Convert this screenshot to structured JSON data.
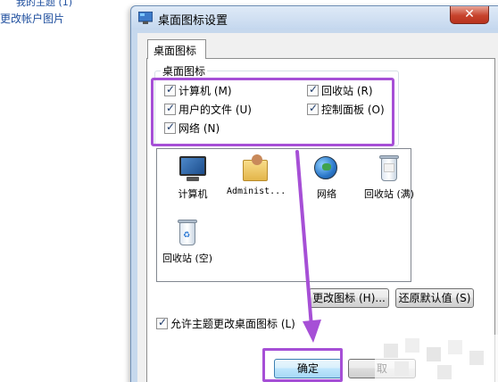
{
  "background": {
    "cut_text": "我的主题 (1)",
    "link": "更改帐户图片"
  },
  "dialog": {
    "title": "桌面图标设置",
    "close_label": "✕",
    "tab_label": "桌面图标",
    "group_label": "桌面图标",
    "checkboxes": {
      "computer": "计算机 (M)",
      "recycle_bin": "回收站 (R)",
      "user_files": "用户的文件 (U)",
      "control_panel": "控制面板 (O)",
      "network": "网络 (N)"
    },
    "icons": [
      {
        "label": "计算机",
        "icon": "computer-icon"
      },
      {
        "label": "Administ...",
        "icon": "user-folder-icon"
      },
      {
        "label": "网络",
        "icon": "network-icon"
      },
      {
        "label": "回收站 (满)",
        "icon": "recycle-bin-full-icon"
      },
      {
        "label": "回收站 (空)",
        "icon": "recycle-bin-empty-icon"
      }
    ],
    "buttons": {
      "change_icon": "更改图标 (H)...",
      "restore_default": "还原默认值 (S)",
      "ok": "确定",
      "cancel": "取"
    },
    "allow_themes_label": "允许主题更改桌面图标 (L)"
  },
  "colors": {
    "highlight": "#a64fd6",
    "title_bar": "#c6d8ed",
    "close_button": "#c7432c"
  }
}
